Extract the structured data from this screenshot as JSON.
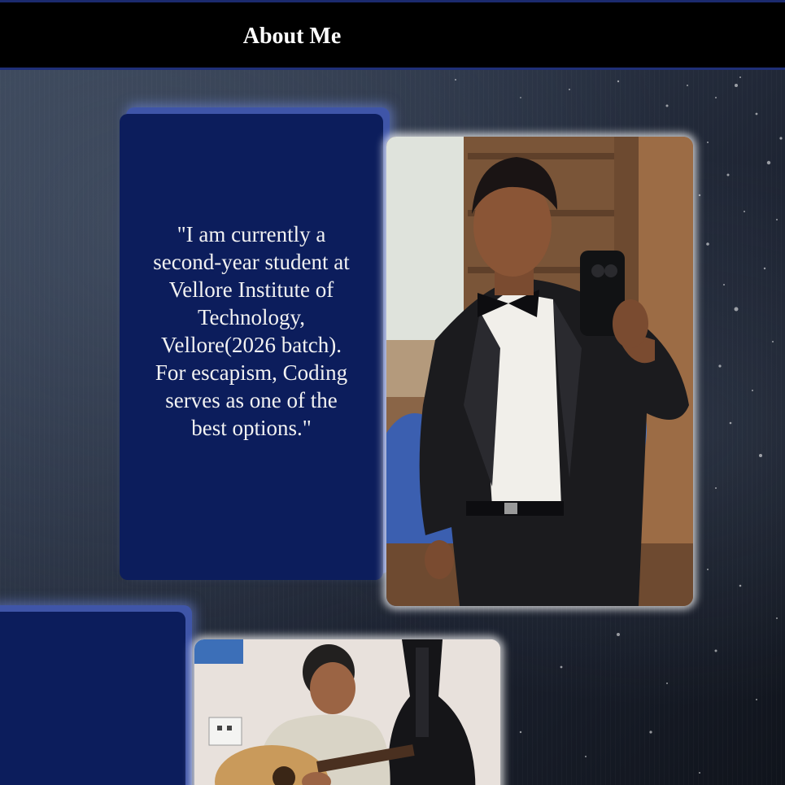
{
  "header": {
    "title": "About Me"
  },
  "about": {
    "quote": "\"I am currently a second-year student at Vellore Institute of Technology, Vellore(2026 batch). For escapism, Coding serves as one of the best options.\""
  },
  "colors": {
    "topbar_bg": "#000000",
    "topbar_border": "#1f2f77",
    "card_bg": "#0c1d5c",
    "card_glow": "#3f55a8",
    "text": "#f2f2f2"
  },
  "photos": [
    {
      "subject": "mirror-selfie-photo"
    },
    {
      "subject": "guitar-photo"
    }
  ]
}
